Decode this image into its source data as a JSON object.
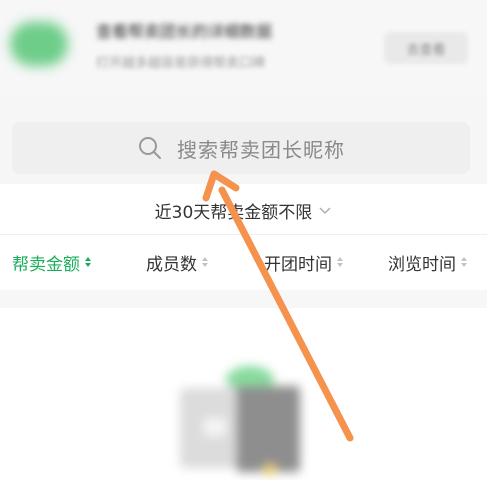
{
  "banner": {
    "title": "查看帮卖团长的详细数据",
    "subtitle": "打开越多越容易获得帮卖口碑",
    "button_label": "去查看"
  },
  "search": {
    "placeholder": "搜索帮卖团长昵称"
  },
  "filter": {
    "label": "近30天帮卖金额不限"
  },
  "sort_columns": [
    {
      "label": "帮卖金额",
      "active": true
    },
    {
      "label": "成员数",
      "active": false
    },
    {
      "label": "开团时间",
      "active": false
    },
    {
      "label": "浏览时间",
      "active": false
    }
  ],
  "colors": {
    "accent": "#1aad5b",
    "arrow": "#f5924e"
  },
  "icons": [
    "search-icon",
    "chevron-down-icon",
    "sort-icon",
    "annotation-arrow-icon"
  ]
}
